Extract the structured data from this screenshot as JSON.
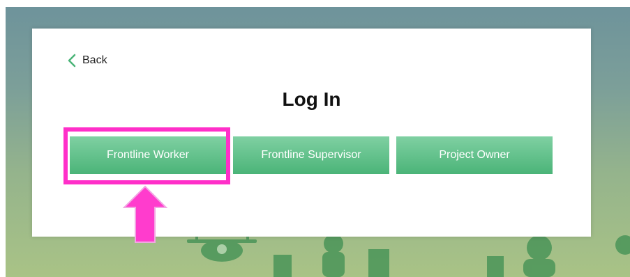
{
  "nav": {
    "back_label": "Back"
  },
  "page": {
    "title": "Log In"
  },
  "roles": [
    {
      "label": "Frontline Worker"
    },
    {
      "label": "Frontline Supervisor"
    },
    {
      "label": "Project Owner"
    }
  ],
  "colors": {
    "accent_green": "#4bb478",
    "highlight": "#ff2fc9"
  },
  "icons": {
    "back": "chevron-left-icon",
    "pointer": "arrow-up-icon"
  }
}
